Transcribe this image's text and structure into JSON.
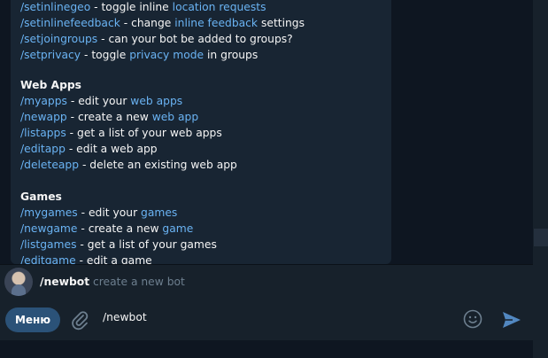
{
  "message": {
    "lines": [
      {
        "cmd": "/setinlinegeo",
        "parts": [
          " - toggle inline ",
          "location requests"
        ],
        "link_index": 1
      },
      {
        "cmd": "/setinlinefeedback",
        "parts": [
          " - change ",
          "inline feedback",
          " settings"
        ]
      },
      {
        "cmd": "/setjoingroups",
        "parts": [
          " - can your bot be added to groups?"
        ]
      },
      {
        "cmd": "/setprivacy",
        "parts": [
          " - toggle ",
          "privacy mode",
          " in groups"
        ]
      }
    ],
    "web_apps": {
      "heading": "Web Apps",
      "items": [
        {
          "cmd": "/myapps",
          "a": " - edit your ",
          "b": "web apps"
        },
        {
          "cmd": "/newapp",
          "a": " - create a new ",
          "b": "web app"
        },
        {
          "cmd": "/listapps",
          "a": " - get a list of your web apps"
        },
        {
          "cmd": "/editapp",
          "a": " - edit a web app"
        },
        {
          "cmd": "/deleteapp",
          "a": " - delete an existing web app"
        }
      ]
    },
    "games": {
      "heading": "Games",
      "items": [
        {
          "cmd": "/mygames",
          "a": " - edit your ",
          "b": "games"
        },
        {
          "cmd": "/newgame",
          "a": " - create a new ",
          "b": "game"
        },
        {
          "cmd": "/listgames",
          "a": " - get a list of your games"
        },
        {
          "cmd": "/editgame",
          "a": " - edit a game"
        }
      ]
    }
  },
  "suggestion": {
    "command": "/newbot",
    "description": "create a new bot"
  },
  "composer": {
    "menu_label": "Меню",
    "input_value": "/newbot"
  },
  "icons": {
    "attach": "paperclip-icon",
    "emoji": "emoji-icon",
    "send": "send-icon"
  },
  "colors": {
    "background": "#0e1621",
    "bubble": "#182533",
    "panel": "#17212b",
    "link": "#6ab3f3",
    "menu_button": "#2b5278"
  }
}
